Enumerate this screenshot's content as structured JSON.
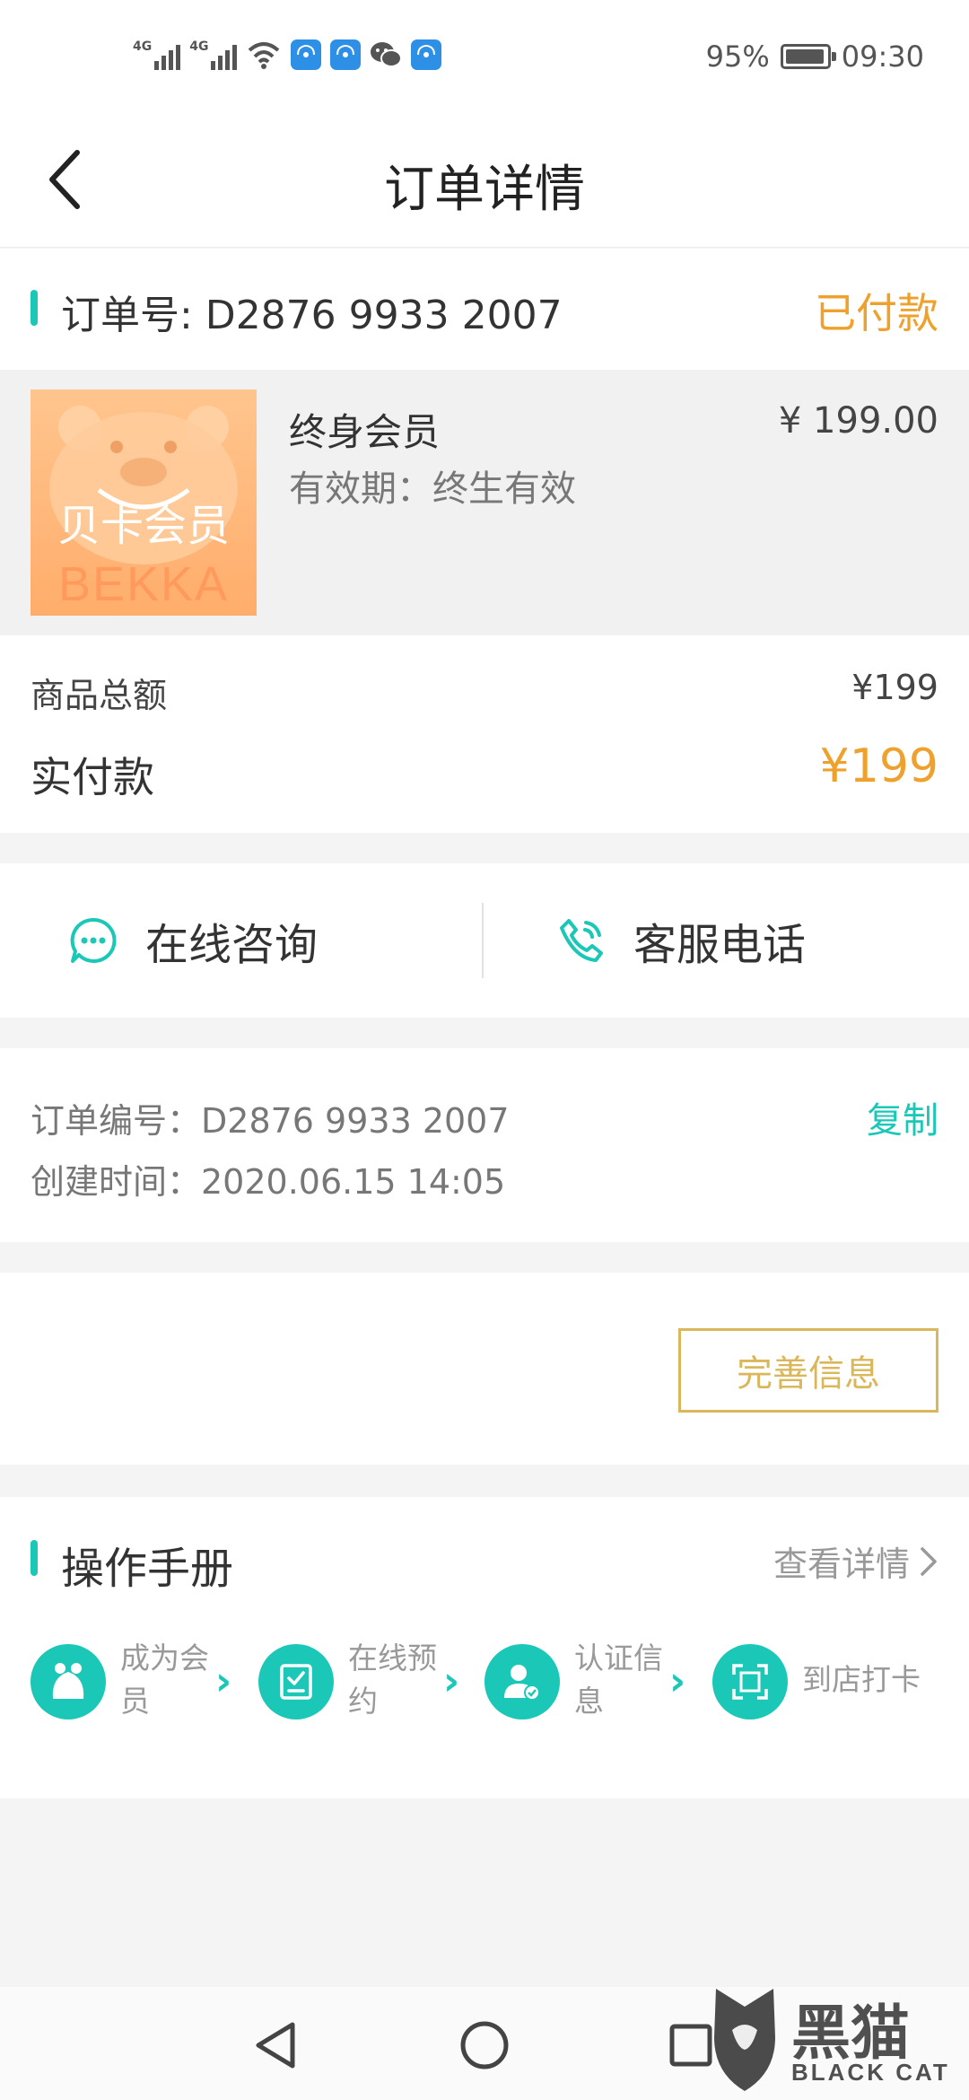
{
  "status_bar": {
    "signal_1": "4G",
    "signal_2": "4G",
    "battery": "95%",
    "time": "09:30",
    "icons": [
      "signal-icon",
      "signal-icon",
      "wifi-icon",
      "app-notification-icon",
      "app-notification-icon",
      "wechat-icon",
      "app-notification-icon"
    ]
  },
  "header": {
    "title": "订单详情",
    "back_icon": "chevron-left-icon"
  },
  "order_summary": {
    "order_label": "订单号: D2876 9933 2007",
    "status": "已付款"
  },
  "product": {
    "image_label": "贝卡会员",
    "image_brand": "BEKKA",
    "name": "终身会员",
    "validity": "有效期：终生有效",
    "price": "¥ 199.00"
  },
  "amounts": {
    "goods_total_label": "商品总额",
    "goods_total_value": "¥199",
    "paid_label": "实付款",
    "paid_value": "¥199"
  },
  "contact": {
    "online_label": "在线咨询",
    "online_icon": "chat-bubble-icon",
    "phone_label": "客服电话",
    "phone_icon": "phone-icon"
  },
  "order_info": {
    "order_number": "订单编号：D2876 9933 2007",
    "created_time": "创建时间：2020.06.15 14:05",
    "copy_label": "复制"
  },
  "actions": {
    "perfect_info_label": "完善信息"
  },
  "manual": {
    "title": "操作手册",
    "more_label": "查看详情",
    "steps": [
      {
        "line1": "成为会",
        "line2": "员",
        "icon": "member-icon"
      },
      {
        "line1": "在线预",
        "line2": "约",
        "icon": "checklist-icon"
      },
      {
        "line1": "认证信",
        "line2": "息",
        "icon": "verified-user-icon"
      },
      {
        "line1": "到店打卡",
        "line2": "",
        "icon": "scan-icon"
      }
    ]
  },
  "nav": {
    "icons": [
      "back-triangle-icon",
      "home-circle-icon",
      "recent-square-icon"
    ]
  },
  "watermark": {
    "line1": "黑猫",
    "line2": "BLACK CAT"
  },
  "colors": {
    "accent_teal": "#1bc7b7",
    "accent_orange": "#efa12e",
    "button_gold": "#d9b75a"
  }
}
